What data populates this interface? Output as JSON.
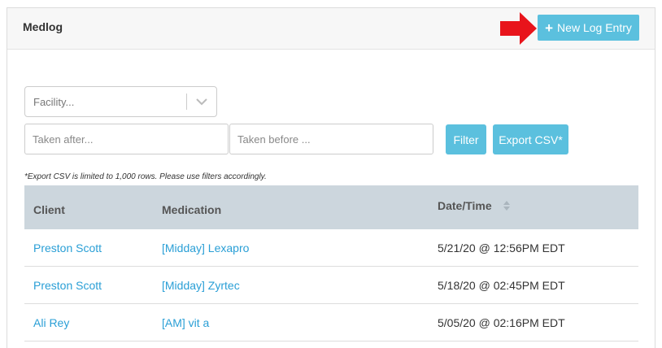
{
  "header": {
    "title": "Medlog",
    "new_entry_label": "New Log Entry"
  },
  "filters": {
    "facility_placeholder": "Facility...",
    "taken_after_placeholder": "Taken after...",
    "taken_before_placeholder": "Taken before ...",
    "filter_label": "Filter",
    "export_label": "Export CSV*",
    "export_note": "*Export CSV is limited to 1,000 rows. Please use filters accordingly."
  },
  "table": {
    "columns": [
      "Client",
      "Medication",
      "Date/Time"
    ],
    "rows": [
      {
        "client": "Preston Scott",
        "medication": "[Midday] Lexapro",
        "datetime": "5/21/20 @ 12:56PM EDT"
      },
      {
        "client": "Preston Scott",
        "medication": "[Midday] Zyrtec",
        "datetime": "5/18/20 @ 02:45PM EDT"
      },
      {
        "client": "Ali Rey",
        "medication": "[AM] vit a",
        "datetime": "5/05/20 @ 02:16PM EDT"
      }
    ]
  },
  "colors": {
    "accent": "#5bc0de",
    "link": "#2a9fd6",
    "table_header": "#ccd6dd",
    "arrow": "#e8141b"
  },
  "icons": [
    "plus-icon",
    "chevron-down-icon",
    "sort-icon",
    "red-arrow-icon"
  ]
}
